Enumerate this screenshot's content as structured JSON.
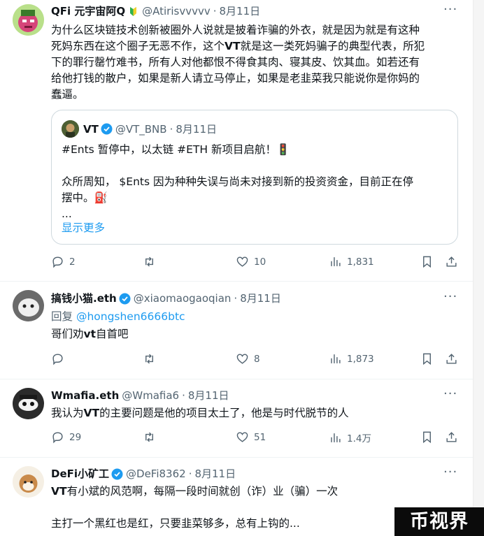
{
  "tweets": [
    {
      "name": "QFi 元宇宙阿Q",
      "handle": "@Atirisvvvvv",
      "dot": "·",
      "time": "8月11日",
      "body_lines": [
        "为什么区块链技术创新被圈外人说就是披着诈骗的外衣，就是因为就是有这种",
        "死妈东西在这个圈子无恶不作，这个",
        "VT",
        "就是这一类死妈骗子的典型代表，所犯",
        "下的罪行罄竹难书，所有人对他都恨不得食其肉、寝其皮、饮其血。如若还有",
        "给他打钱的散户，如果是新人请立马停止，如果是老韭菜我只能说你是你妈的",
        "蠢逼。"
      ],
      "quote": {
        "name": "VT",
        "handle": "@VT_BNB",
        "dot": "·",
        "time": "8月11日",
        "line1": "#Ents 暂停中，以太链 #ETH 新项目启航！🚦",
        "line2": "众所周知， $Ents 因为种种失误与尚未对接到新的投资资金，目前正在停",
        "line3": "摆中。⛽",
        "line4": "...",
        "show_more": "显示更多"
      },
      "replies": "2",
      "likes": "10",
      "views": "1,831"
    },
    {
      "name": "搞钱小猫.eth",
      "handle": "@xiaomaogaoqian",
      "dot": "·",
      "time": "8月11日",
      "reply_prefix": "回复 ",
      "reply_to": "@hongshen6666btc",
      "body_pre": "哥们劝",
      "body_bold": "vt",
      "body_post": "自首吧",
      "replies": "",
      "likes": "8",
      "views": "1,873"
    },
    {
      "name": "Wmafia.eth",
      "handle": "@Wmafia6",
      "dot": "·",
      "time": "8月11日",
      "body_pre": "我认为",
      "body_bold": "VT",
      "body_post": "的主要问题是他的项目太土了，他是与时代脱节的人",
      "replies": "29",
      "likes": "51",
      "views": "1.4万"
    },
    {
      "name": "DeFi小矿工",
      "handle": "@DeFi8362",
      "dot": "·",
      "time": "8月11日",
      "body_bold": "VT",
      "body_post": "有小斌的风范啊，每隔一段时间就创（诈）业（骗）一次",
      "body_line2": "主打一个黑红也是红，只要韭菜够多，总有上钩的..."
    }
  ],
  "more_glyph": "···",
  "watermark": "币视界",
  "colors": {
    "accent": "#1d9bf0",
    "muted": "#536471",
    "verified": "#1d9bf0"
  },
  "icons": [
    "reply-icon",
    "retweet-icon",
    "like-icon",
    "views-icon",
    "bookmark-icon",
    "share-icon",
    "verified-icon",
    "more-icon"
  ]
}
